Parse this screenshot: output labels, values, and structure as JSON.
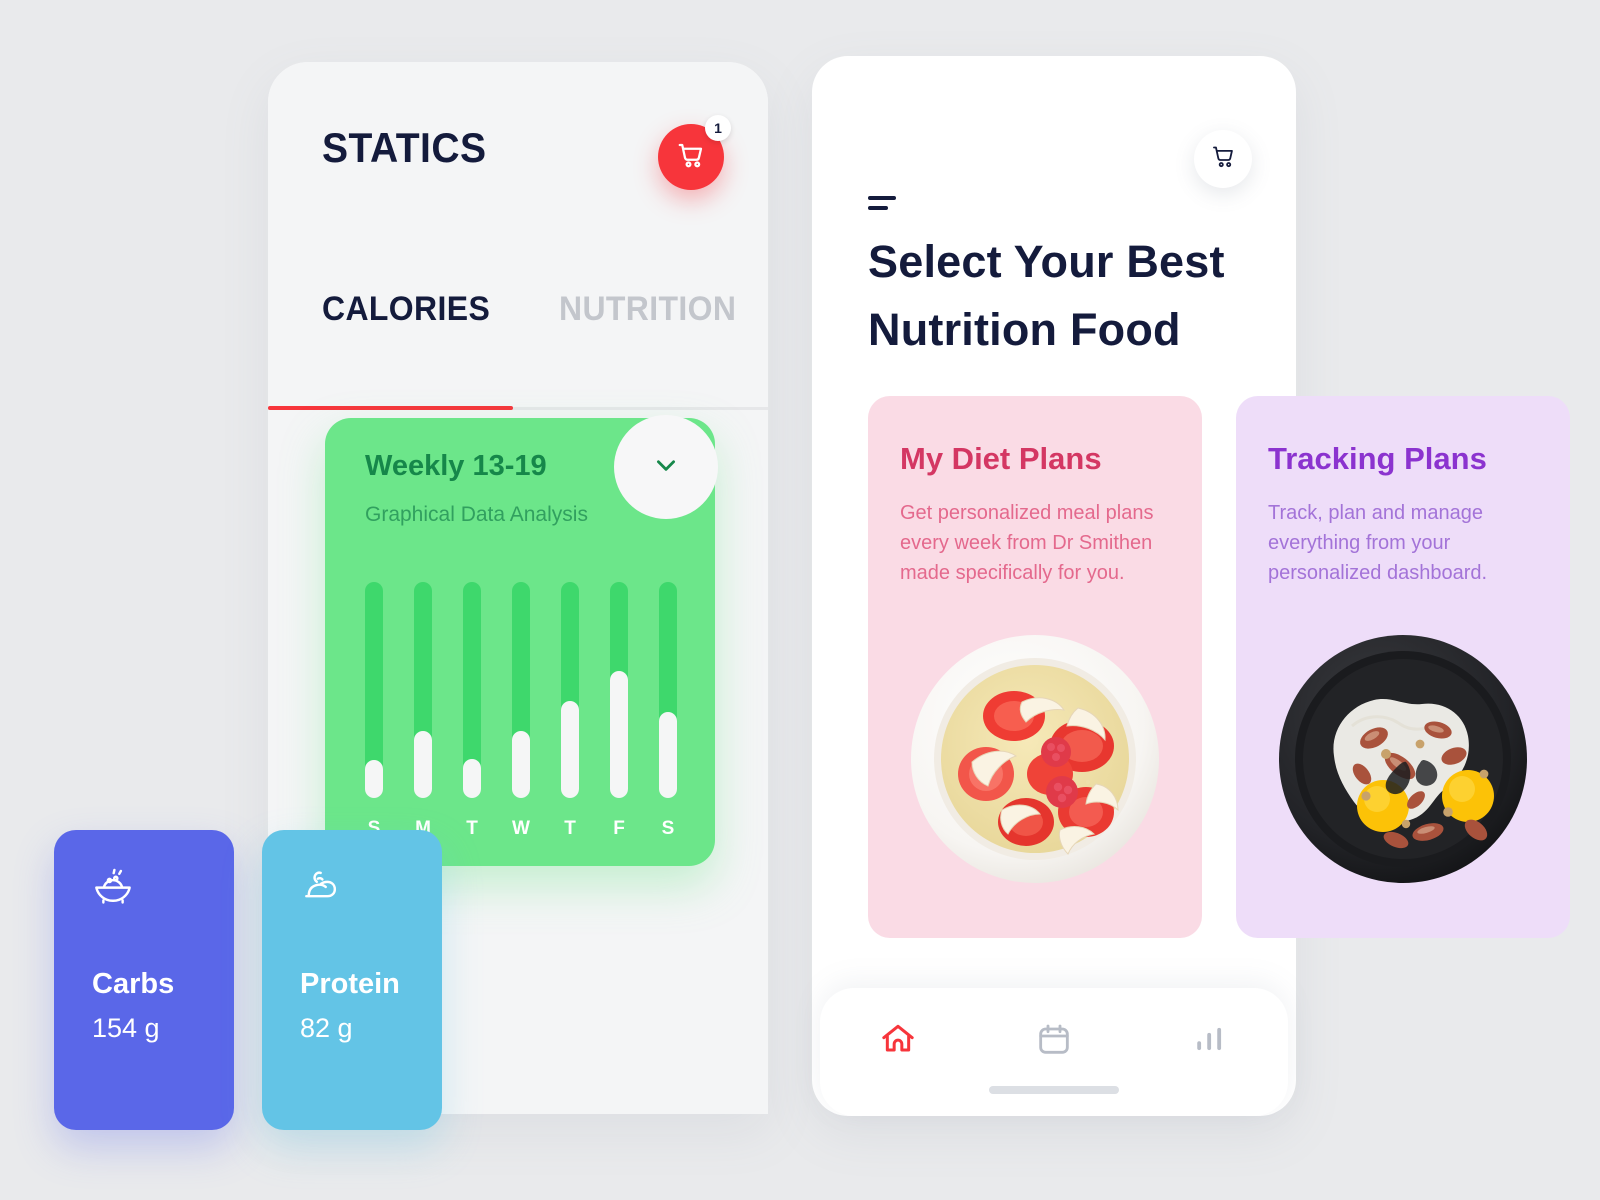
{
  "left_phone": {
    "title": "STATICS",
    "cart": {
      "icon": "shopping-cart-icon",
      "badge_count": "1",
      "color": "#f7353b"
    },
    "tabs": [
      {
        "label": "CALORIES",
        "active": true
      },
      {
        "label": "NUTRITION",
        "active": false
      }
    ],
    "chart_card": {
      "title": "Weekly 13-19",
      "subtitle": "Graphical Data Analysis",
      "expand_icon": "chevron-down-icon",
      "bg_color": "#6ce68a"
    },
    "macros": [
      {
        "name": "Carbs",
        "value": "154 g",
        "icon": "rice-bowl-icon",
        "color": "#5a67e8"
      },
      {
        "name": "Protein",
        "value": "82 g",
        "icon": "bicep-muscle-icon",
        "color": "#63c4e6"
      }
    ]
  },
  "right_phone": {
    "menu_icon": "hamburger-menu-icon",
    "cart_icon": "shopping-cart-icon",
    "heading": "Select Your Best Nutrition Food",
    "plans": [
      {
        "title": "My Diet Plans",
        "description": "Get personalized meal plans every week from Dr Smithen made specifically for you.",
        "bg_color": "#fadbe5",
        "title_color": "#d43763",
        "image": "strawberry-porridge-bowl"
      },
      {
        "title": "Tracking Plans",
        "description": "Track, plan and manage everything from your personalized dashboard.",
        "bg_color": "#eeddf9",
        "title_color": "#8b33cf",
        "image": "fried-eggs-bacon-pan"
      }
    ],
    "bottom_nav": [
      {
        "icon": "home-icon",
        "active": true,
        "color": "#f7353b"
      },
      {
        "icon": "calendar-icon",
        "active": false,
        "color": "#b7bcc6"
      },
      {
        "icon": "bar-chart-icon",
        "active": false,
        "color": "#b7bcc6"
      }
    ]
  },
  "chart_data": {
    "type": "bar",
    "title": "Weekly 13-19",
    "subtitle": "Graphical Data Analysis",
    "categories": [
      "S",
      "M",
      "T",
      "W",
      "T",
      "F",
      "S"
    ],
    "values": [
      17,
      31,
      18,
      31,
      45,
      59,
      40
    ],
    "ylim": [
      0,
      100
    ],
    "xlabel": "",
    "ylabel": "",
    "grid": false,
    "legend": "none",
    "series_color": "#f5f6f6",
    "track_color": "#3ed86c"
  }
}
